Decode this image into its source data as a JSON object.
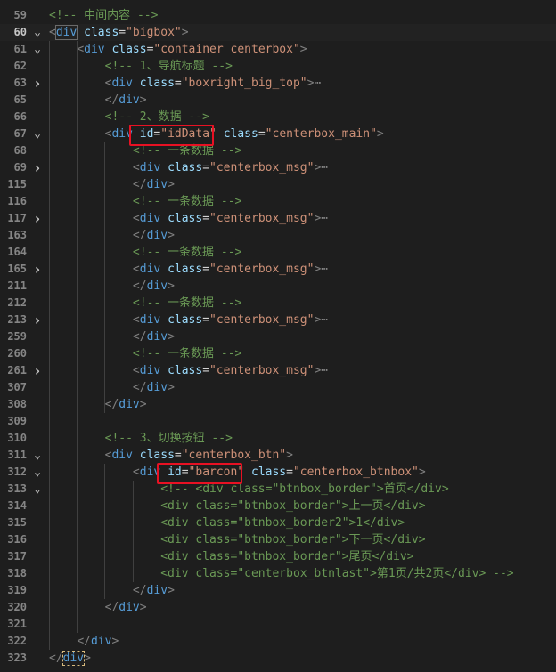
{
  "editor": {
    "lines": [
      {
        "n": "59",
        "fold": "",
        "indent": "",
        "tokens": [
          {
            "t": "c",
            "v": "<!-- 中间内容 -->"
          }
        ]
      },
      {
        "n": "60",
        "fold": "v",
        "current": true,
        "indent": "",
        "tokens": [
          {
            "t": "p",
            "v": "<"
          },
          {
            "t": "t",
            "v": "div"
          },
          {
            "t": "x",
            "v": " "
          },
          {
            "t": "a",
            "v": "class"
          },
          {
            "t": "x",
            "v": "="
          },
          {
            "t": "s",
            "v": "\"bigbox\""
          },
          {
            "t": "p",
            "v": ">"
          }
        ]
      },
      {
        "n": "61",
        "fold": "v",
        "indent": "    ",
        "tokens": [
          {
            "t": "p",
            "v": "<"
          },
          {
            "t": "t",
            "v": "div"
          },
          {
            "t": "x",
            "v": " "
          },
          {
            "t": "a",
            "v": "class"
          },
          {
            "t": "x",
            "v": "="
          },
          {
            "t": "s",
            "v": "\"container centerbox\""
          },
          {
            "t": "p",
            "v": ">"
          }
        ]
      },
      {
        "n": "62",
        "fold": "",
        "indent": "        ",
        "tokens": [
          {
            "t": "c",
            "v": "<!-- 1、导航标题 -->"
          }
        ]
      },
      {
        "n": "63",
        "fold": ">",
        "indent": "        ",
        "tokens": [
          {
            "t": "p",
            "v": "<"
          },
          {
            "t": "t",
            "v": "div"
          },
          {
            "t": "x",
            "v": " "
          },
          {
            "t": "a",
            "v": "class"
          },
          {
            "t": "x",
            "v": "="
          },
          {
            "t": "s",
            "v": "\"boxright_big_top\""
          },
          {
            "t": "p",
            "v": ">"
          },
          {
            "t": "e",
            "v": "⋯"
          }
        ]
      },
      {
        "n": "65",
        "fold": "",
        "indent": "        ",
        "tokens": [
          {
            "t": "p",
            "v": "</"
          },
          {
            "t": "t",
            "v": "div"
          },
          {
            "t": "p",
            "v": ">"
          }
        ]
      },
      {
        "n": "66",
        "fold": "",
        "indent": "        ",
        "tokens": [
          {
            "t": "c",
            "v": "<!-- 2、数据 -->"
          }
        ]
      },
      {
        "n": "67",
        "fold": "v",
        "indent": "        ",
        "tokens": [
          {
            "t": "p",
            "v": "<"
          },
          {
            "t": "t",
            "v": "div"
          },
          {
            "t": "x",
            "v": " "
          },
          {
            "t": "a",
            "v": "id"
          },
          {
            "t": "x",
            "v": "="
          },
          {
            "t": "s",
            "v": "\"idData\""
          },
          {
            "t": "x",
            "v": " "
          },
          {
            "t": "a",
            "v": "class"
          },
          {
            "t": "x",
            "v": "="
          },
          {
            "t": "s",
            "v": "\"centerbox_main\""
          },
          {
            "t": "p",
            "v": ">"
          }
        ]
      },
      {
        "n": "68",
        "fold": "",
        "indent": "            ",
        "tokens": [
          {
            "t": "c",
            "v": "<!-- 一条数据 -->"
          }
        ]
      },
      {
        "n": "69",
        "fold": ">",
        "indent": "            ",
        "tokens": [
          {
            "t": "p",
            "v": "<"
          },
          {
            "t": "t",
            "v": "div"
          },
          {
            "t": "x",
            "v": " "
          },
          {
            "t": "a",
            "v": "class"
          },
          {
            "t": "x",
            "v": "="
          },
          {
            "t": "s",
            "v": "\"centerbox_msg\""
          },
          {
            "t": "p",
            "v": ">"
          },
          {
            "t": "e",
            "v": "⋯"
          }
        ]
      },
      {
        "n": "115",
        "fold": "",
        "indent": "            ",
        "tokens": [
          {
            "t": "p",
            "v": "</"
          },
          {
            "t": "t",
            "v": "div"
          },
          {
            "t": "p",
            "v": ">"
          }
        ]
      },
      {
        "n": "116",
        "fold": "",
        "indent": "            ",
        "tokens": [
          {
            "t": "c",
            "v": "<!-- 一条数据 -->"
          }
        ]
      },
      {
        "n": "117",
        "fold": ">",
        "indent": "            ",
        "tokens": [
          {
            "t": "p",
            "v": "<"
          },
          {
            "t": "t",
            "v": "div"
          },
          {
            "t": "x",
            "v": " "
          },
          {
            "t": "a",
            "v": "class"
          },
          {
            "t": "x",
            "v": "="
          },
          {
            "t": "s",
            "v": "\"centerbox_msg\""
          },
          {
            "t": "p",
            "v": ">"
          },
          {
            "t": "e",
            "v": "⋯"
          }
        ]
      },
      {
        "n": "163",
        "fold": "",
        "indent": "            ",
        "tokens": [
          {
            "t": "p",
            "v": "</"
          },
          {
            "t": "t",
            "v": "div"
          },
          {
            "t": "p",
            "v": ">"
          }
        ]
      },
      {
        "n": "164",
        "fold": "",
        "indent": "            ",
        "tokens": [
          {
            "t": "c",
            "v": "<!-- 一条数据 -->"
          }
        ]
      },
      {
        "n": "165",
        "fold": ">",
        "indent": "            ",
        "tokens": [
          {
            "t": "p",
            "v": "<"
          },
          {
            "t": "t",
            "v": "div"
          },
          {
            "t": "x",
            "v": " "
          },
          {
            "t": "a",
            "v": "class"
          },
          {
            "t": "x",
            "v": "="
          },
          {
            "t": "s",
            "v": "\"centerbox_msg\""
          },
          {
            "t": "p",
            "v": ">"
          },
          {
            "t": "e",
            "v": "⋯"
          }
        ]
      },
      {
        "n": "211",
        "fold": "",
        "indent": "            ",
        "tokens": [
          {
            "t": "p",
            "v": "</"
          },
          {
            "t": "t",
            "v": "div"
          },
          {
            "t": "p",
            "v": ">"
          }
        ]
      },
      {
        "n": "212",
        "fold": "",
        "indent": "            ",
        "tokens": [
          {
            "t": "c",
            "v": "<!-- 一条数据 -->"
          }
        ]
      },
      {
        "n": "213",
        "fold": ">",
        "indent": "            ",
        "tokens": [
          {
            "t": "p",
            "v": "<"
          },
          {
            "t": "t",
            "v": "div"
          },
          {
            "t": "x",
            "v": " "
          },
          {
            "t": "a",
            "v": "class"
          },
          {
            "t": "x",
            "v": "="
          },
          {
            "t": "s",
            "v": "\"centerbox_msg\""
          },
          {
            "t": "p",
            "v": ">"
          },
          {
            "t": "e",
            "v": "⋯"
          }
        ]
      },
      {
        "n": "259",
        "fold": "",
        "indent": "            ",
        "tokens": [
          {
            "t": "p",
            "v": "</"
          },
          {
            "t": "t",
            "v": "div"
          },
          {
            "t": "p",
            "v": ">"
          }
        ]
      },
      {
        "n": "260",
        "fold": "",
        "indent": "            ",
        "tokens": [
          {
            "t": "c",
            "v": "<!-- 一条数据 -->"
          }
        ]
      },
      {
        "n": "261",
        "fold": ">",
        "indent": "            ",
        "tokens": [
          {
            "t": "p",
            "v": "<"
          },
          {
            "t": "t",
            "v": "div"
          },
          {
            "t": "x",
            "v": " "
          },
          {
            "t": "a",
            "v": "class"
          },
          {
            "t": "x",
            "v": "="
          },
          {
            "t": "s",
            "v": "\"centerbox_msg\""
          },
          {
            "t": "p",
            "v": ">"
          },
          {
            "t": "e",
            "v": "⋯"
          }
        ]
      },
      {
        "n": "307",
        "fold": "",
        "indent": "            ",
        "tokens": [
          {
            "t": "p",
            "v": "</"
          },
          {
            "t": "t",
            "v": "div"
          },
          {
            "t": "p",
            "v": ">"
          }
        ]
      },
      {
        "n": "308",
        "fold": "",
        "indent": "        ",
        "tokens": [
          {
            "t": "p",
            "v": "</"
          },
          {
            "t": "t",
            "v": "div"
          },
          {
            "t": "p",
            "v": ">"
          }
        ]
      },
      {
        "n": "309",
        "fold": "",
        "indent": "",
        "tokens": []
      },
      {
        "n": "310",
        "fold": "",
        "indent": "        ",
        "tokens": [
          {
            "t": "c",
            "v": "<!-- 3、切换按钮 -->"
          }
        ]
      },
      {
        "n": "311",
        "fold": "v",
        "indent": "        ",
        "tokens": [
          {
            "t": "p",
            "v": "<"
          },
          {
            "t": "t",
            "v": "div"
          },
          {
            "t": "x",
            "v": " "
          },
          {
            "t": "a",
            "v": "class"
          },
          {
            "t": "x",
            "v": "="
          },
          {
            "t": "s",
            "v": "\"centerbox_btn\""
          },
          {
            "t": "p",
            "v": ">"
          }
        ]
      },
      {
        "n": "312",
        "fold": "v",
        "indent": "            ",
        "tokens": [
          {
            "t": "p",
            "v": "<"
          },
          {
            "t": "t",
            "v": "div"
          },
          {
            "t": "x",
            "v": " "
          },
          {
            "t": "a",
            "v": "id"
          },
          {
            "t": "x",
            "v": "="
          },
          {
            "t": "s",
            "v": "\"barcon\""
          },
          {
            "t": "x",
            "v": " "
          },
          {
            "t": "a",
            "v": "class"
          },
          {
            "t": "x",
            "v": "="
          },
          {
            "t": "s",
            "v": "\"centerbox_btnbox\""
          },
          {
            "t": "p",
            "v": ">"
          }
        ]
      },
      {
        "n": "313",
        "fold": "v",
        "indent": "                ",
        "tokens": [
          {
            "t": "c",
            "v": "<!-- <div class=\"btnbox_border\">首页</div>"
          }
        ]
      },
      {
        "n": "314",
        "fold": "",
        "indent": "                ",
        "tokens": [
          {
            "t": "c",
            "v": "<div class=\"btnbox_border\">上一页</div>"
          }
        ]
      },
      {
        "n": "315",
        "fold": "",
        "indent": "                ",
        "tokens": [
          {
            "t": "c",
            "v": "<div class=\"btnbox_border2\">1</div>"
          }
        ]
      },
      {
        "n": "316",
        "fold": "",
        "indent": "                ",
        "tokens": [
          {
            "t": "c",
            "v": "<div class=\"btnbox_border\">下一页</div>"
          }
        ]
      },
      {
        "n": "317",
        "fold": "",
        "indent": "                ",
        "tokens": [
          {
            "t": "c",
            "v": "<div class=\"btnbox_border\">尾页</div>"
          }
        ]
      },
      {
        "n": "318",
        "fold": "",
        "indent": "                ",
        "tokens": [
          {
            "t": "c",
            "v": "<div class=\"centerbox_btnlast\">第1页/共2页</div> -->"
          }
        ]
      },
      {
        "n": "319",
        "fold": "",
        "indent": "            ",
        "tokens": [
          {
            "t": "p",
            "v": "</"
          },
          {
            "t": "t",
            "v": "div"
          },
          {
            "t": "p",
            "v": ">"
          }
        ]
      },
      {
        "n": "320",
        "fold": "",
        "indent": "        ",
        "tokens": [
          {
            "t": "p",
            "v": "</"
          },
          {
            "t": "t",
            "v": "div"
          },
          {
            "t": "p",
            "v": ">"
          }
        ]
      },
      {
        "n": "321",
        "fold": "",
        "indent": "",
        "tokens": []
      },
      {
        "n": "322",
        "fold": "",
        "indent": "    ",
        "tokens": [
          {
            "t": "p",
            "v": "</"
          },
          {
            "t": "t",
            "v": "div"
          },
          {
            "t": "p",
            "v": ">"
          }
        ]
      },
      {
        "n": "323",
        "fold": "",
        "indent": "",
        "tokens": [
          {
            "t": "p",
            "v": "</"
          },
          {
            "t": "t",
            "v": "div"
          },
          {
            "t": "p",
            "v": ">"
          }
        ]
      }
    ]
  },
  "colors": {
    "background": "#1e1e1e",
    "comment": "#6a9955",
    "tag": "#569cd6",
    "attribute": "#9cdcfe",
    "string": "#ce9178",
    "highlight_box": "#e81123"
  }
}
